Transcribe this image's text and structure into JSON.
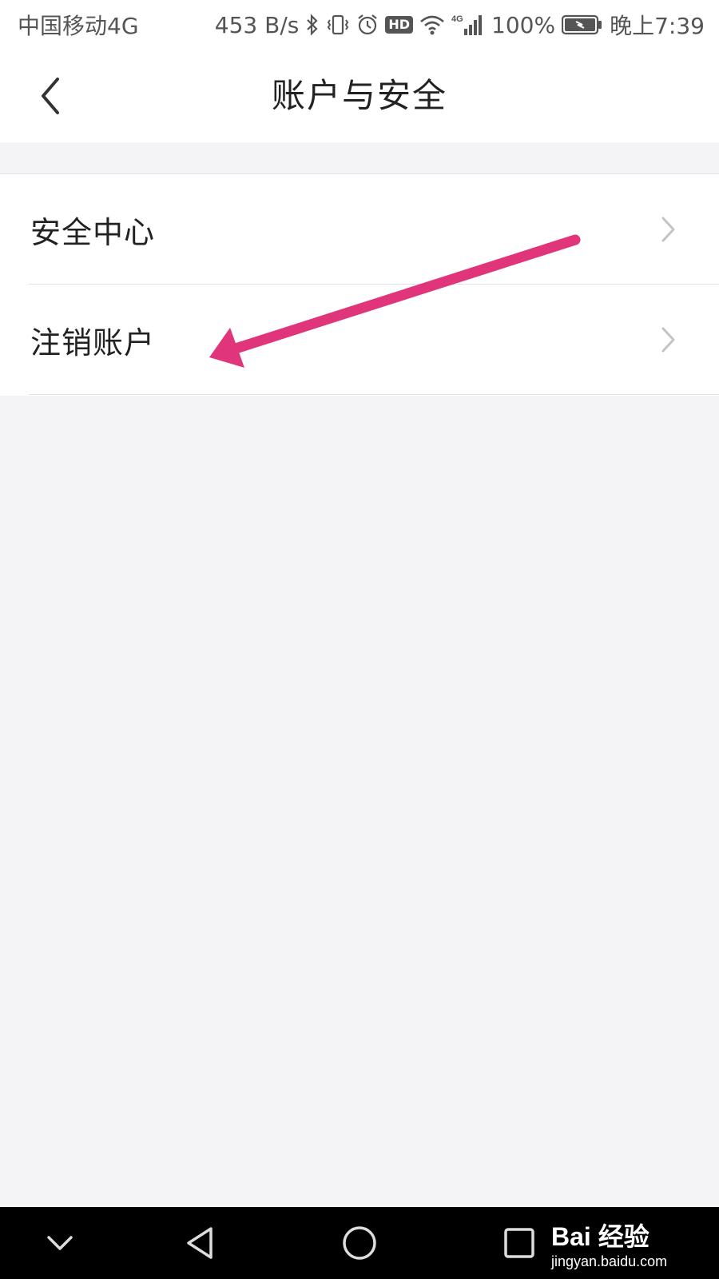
{
  "status_bar": {
    "carrier": "中国移动4G",
    "speed": "453 B/s",
    "signal_label": "4G",
    "battery": "100%",
    "time": "晚上7:39",
    "hd": "HD",
    "icons": [
      "bluetooth-icon",
      "vibrate-icon",
      "alarm-icon",
      "hd-icon",
      "wifi-icon",
      "cellular-signal-icon",
      "battery-icon"
    ]
  },
  "header": {
    "title": "账户与安全",
    "back_icon": "back-chevron-icon"
  },
  "menu": {
    "items": [
      {
        "label": "安全中心"
      },
      {
        "label": "注销账户"
      }
    ]
  },
  "annotation": {
    "color": "#e0357a"
  },
  "nav_bar": {
    "buttons": [
      "collapse-icon",
      "back-triangle-icon",
      "home-circle-icon",
      "recents-square-icon"
    ]
  },
  "watermark": {
    "brand": "Bai 经验",
    "url": "jingyan.baidu.com"
  }
}
